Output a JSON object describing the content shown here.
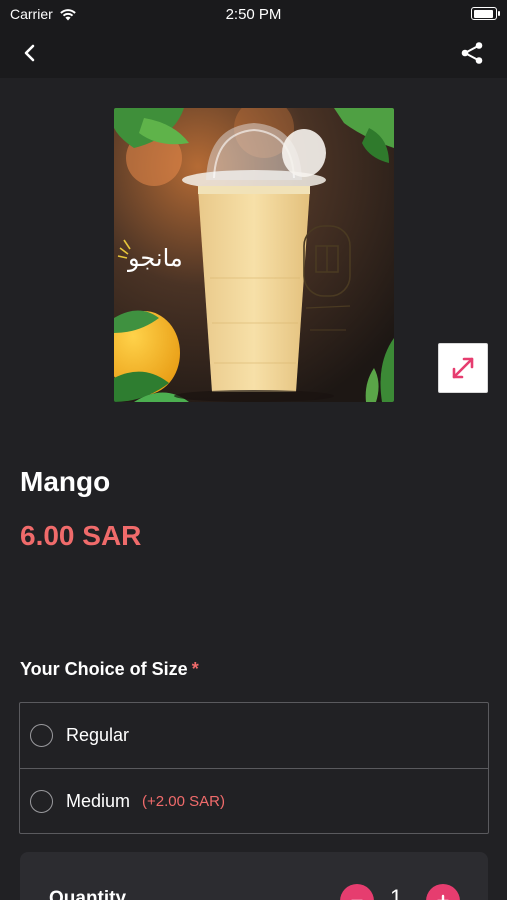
{
  "status_bar": {
    "carrier": "Carrier",
    "time": "2:50 PM",
    "battery_level": 0.95
  },
  "nav": {
    "back_icon": "chevron-left-icon",
    "share_icon": "share-icon"
  },
  "product": {
    "image_text": "مانجو",
    "expand_icon": "expand-icon",
    "title": "Mango",
    "price": "6.00 SAR"
  },
  "size_section": {
    "title": "Your Choice of Size",
    "required_mark": "*",
    "options": [
      {
        "label": "Regular",
        "extra": ""
      },
      {
        "label": "Medium",
        "extra": "(+2.00 SAR)"
      }
    ]
  },
  "quantity": {
    "label": "Quantity",
    "value": "1"
  },
  "colors": {
    "accent": "#f06b6b",
    "button": "#e63d6f",
    "background": "#212124"
  }
}
